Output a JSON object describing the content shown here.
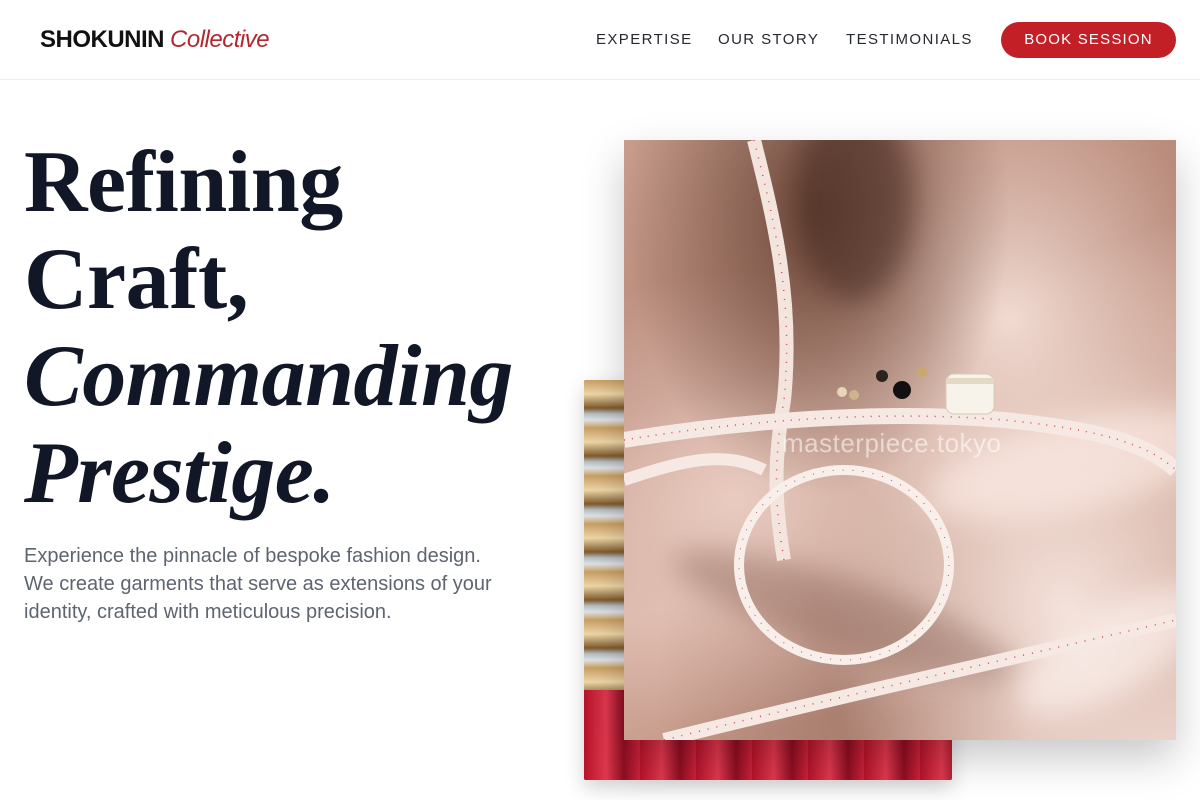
{
  "brand": {
    "strong": "SHOKUNIN",
    "italic": "Collective",
    "accent_color": "#b3272d"
  },
  "nav": {
    "items": [
      {
        "label": "EXPERTISE"
      },
      {
        "label": "OUR STORY"
      },
      {
        "label": "TESTIMONIALS"
      }
    ],
    "cta_label": "BOOK SESSION",
    "cta_color": "#c21f27"
  },
  "hero": {
    "title_lines": [
      "Refining",
      "Craft,",
      "Commanding",
      "Prestige."
    ],
    "description": "Experience the pinnacle of bespoke fashion design. We create garments that serve as extensions of your identity, crafted with meticulous precision."
  },
  "imagery": {
    "front_watermark": "masterpiece.tokyo",
    "front_subject": "silk fabric with measuring tape",
    "back_subject": "thread spools"
  }
}
